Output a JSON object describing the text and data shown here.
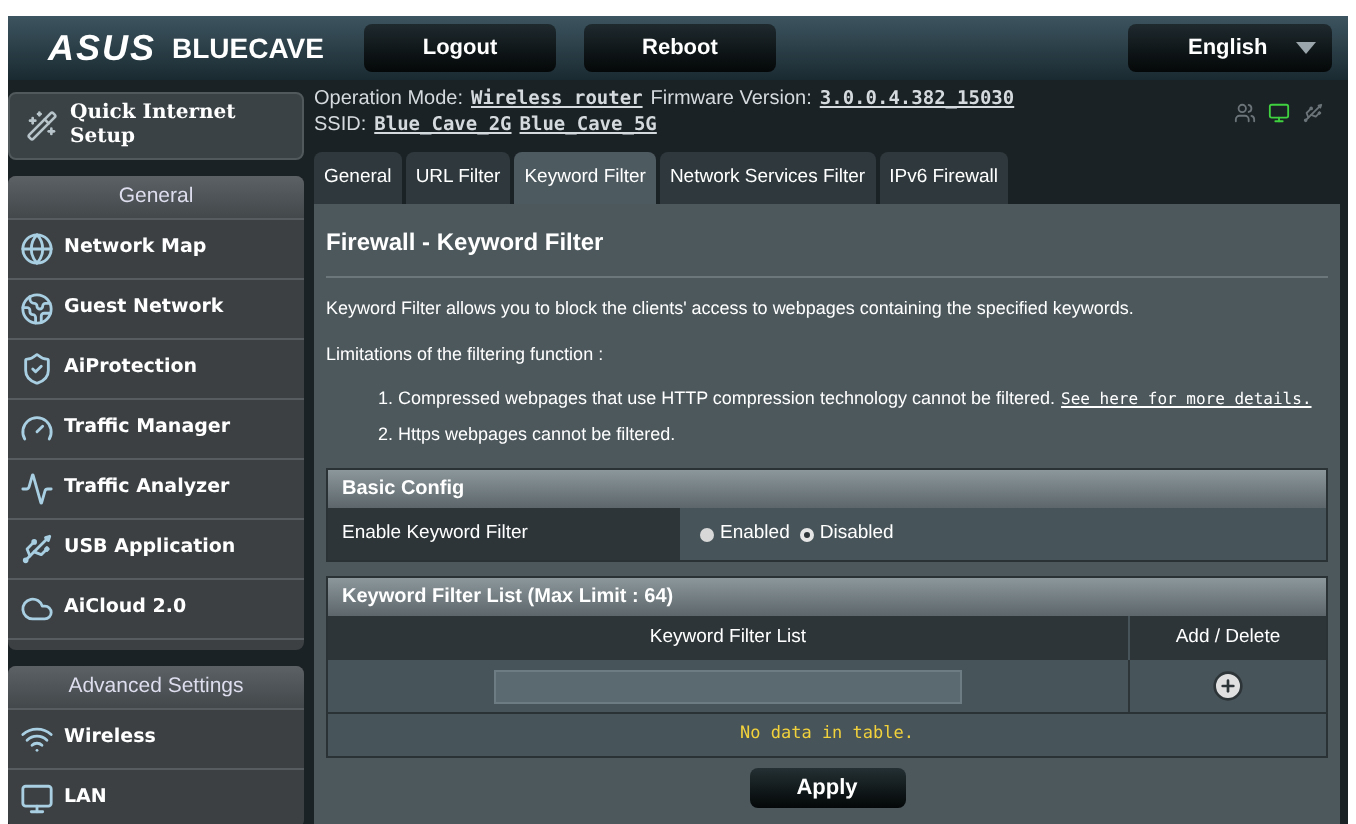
{
  "header": {
    "logo": "ASUS",
    "product": "BLUECAVE",
    "buttons": [
      "Logout",
      "Reboot"
    ],
    "language": "English"
  },
  "sidebar": {
    "quick_setup": "Quick Internet Setup",
    "sections": [
      {
        "title": "General",
        "items": [
          {
            "label": "Network Map"
          },
          {
            "label": "Guest Network"
          },
          {
            "label": "AiProtection"
          },
          {
            "label": "Traffic Manager"
          },
          {
            "label": "Traffic Analyzer"
          },
          {
            "label": "USB Application"
          },
          {
            "label": "AiCloud 2.0"
          }
        ]
      },
      {
        "title": "Advanced Settings",
        "items": [
          {
            "label": "Wireless"
          },
          {
            "label": "LAN"
          }
        ]
      }
    ]
  },
  "status": {
    "mode_label": "Operation Mode:",
    "mode": "Wireless router",
    "firmware_label": "Firmware Version:",
    "firmware": "3.0.0.4.382_15030",
    "ssid_label": "SSID:",
    "ssids": [
      "Blue_Cave_2G",
      "Blue_Cave_5G"
    ]
  },
  "tabs": [
    {
      "label": "General",
      "selected": false
    },
    {
      "label": "URL Filter",
      "selected": false
    },
    {
      "label": "Keyword Filter",
      "selected": true
    },
    {
      "label": "Network Services Filter",
      "selected": false
    },
    {
      "label": "IPv6 Firewall",
      "selected": false
    }
  ],
  "page": {
    "title": "Firewall - Keyword Filter",
    "description": "Keyword Filter allows you to block the clients' access to webpages containing the specified keywords.",
    "limitations_title": "Limitations of the filtering function :",
    "limitations": [
      {
        "text": "1. Compressed webpages that use HTTP compression technology cannot be filtered.",
        "link": "See here for more details."
      },
      {
        "text": "2. Https webpages cannot be filtered."
      }
    ]
  },
  "basic_config": {
    "title": "Basic Config",
    "label": "Enable Keyword Filter",
    "options": [
      {
        "label": "Enabled",
        "selected": false
      },
      {
        "label": "Disabled",
        "selected": true
      }
    ]
  },
  "filter_list": {
    "title": "Keyword Filter List (Max Limit : 64)",
    "columns": [
      "Keyword Filter List",
      "Add / Delete"
    ],
    "empty": "No data in table."
  },
  "apply": "Apply"
}
